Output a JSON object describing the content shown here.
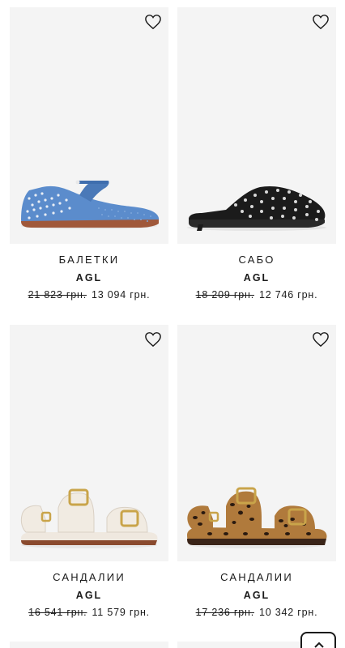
{
  "products": [
    {
      "title": "БАЛЕТКИ",
      "brand": "AGL",
      "old_price": "21 823 грн.",
      "new_price": "13 094 грн.",
      "image": "blue-perforated-mary-jane-flat",
      "favorite_icon": "heart-outline-icon"
    },
    {
      "title": "САБО",
      "brand": "AGL",
      "old_price": "18 209 грн.",
      "new_price": "12 746 грн.",
      "image": "black-studded-mule",
      "favorite_icon": "heart-outline-icon"
    },
    {
      "title": "САНДАЛИИ",
      "brand": "AGL",
      "old_price": "16 541 грн.",
      "new_price": "11 579 грн.",
      "image": "white-buckle-sandal",
      "favorite_icon": "heart-outline-icon"
    },
    {
      "title": "САНДАЛИИ",
      "brand": "AGL",
      "old_price": "17 236 грн.",
      "new_price": "10 342 грн.",
      "image": "leopard-buckle-sandal",
      "favorite_icon": "heart-outline-icon"
    }
  ],
  "scroll_top_icon": "chevron-up-icon",
  "colors": {
    "image_background": "#f4f4f4",
    "text": "#1a1a1a",
    "blue_shoe": "#5b8ccc",
    "black_shoe": "#1b1b1b",
    "cream_shoe": "#f1ebe2",
    "gold_buckle": "#c9a44a",
    "leopard_base": "#b07a3c"
  }
}
